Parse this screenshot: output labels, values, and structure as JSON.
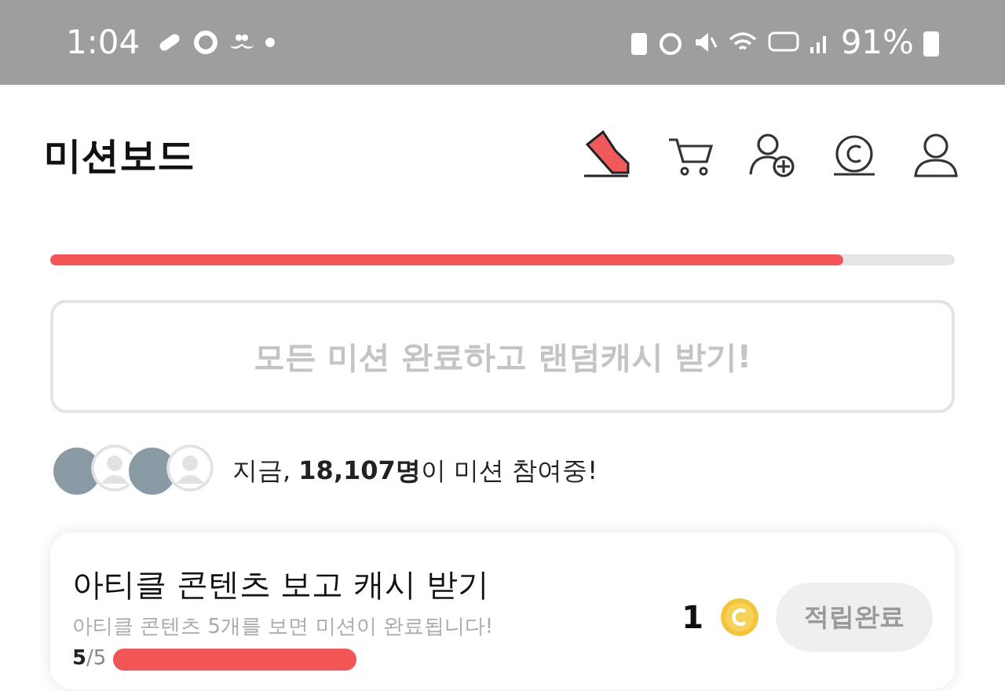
{
  "status_bar": {
    "time": "1:04",
    "battery": "91%"
  },
  "header": {
    "title": "미션보드"
  },
  "overall_progress": {
    "level": 0.877
  },
  "claim_all_button": {
    "label": "모든 미션 완료하고 랜덤캐시 받기!",
    "disabled": true
  },
  "participants": {
    "avatars": [
      {
        "kind": "photo"
      },
      {
        "kind": "default"
      },
      {
        "kind": "photo"
      },
      {
        "kind": "default"
      }
    ],
    "text": "지금, **18,107명**이 미션 참여중!"
  },
  "missions": [
    {
      "title": "아티클 콘텐츠 보고 캐시 받기",
      "description": "아티클 콘텐츠 5개를 보면 미션이 완료됩니다!",
      "done": "5",
      "total": "/5",
      "level": 1,
      "reward": "1",
      "button": "적립완료",
      "disabled": true
    }
  ]
}
